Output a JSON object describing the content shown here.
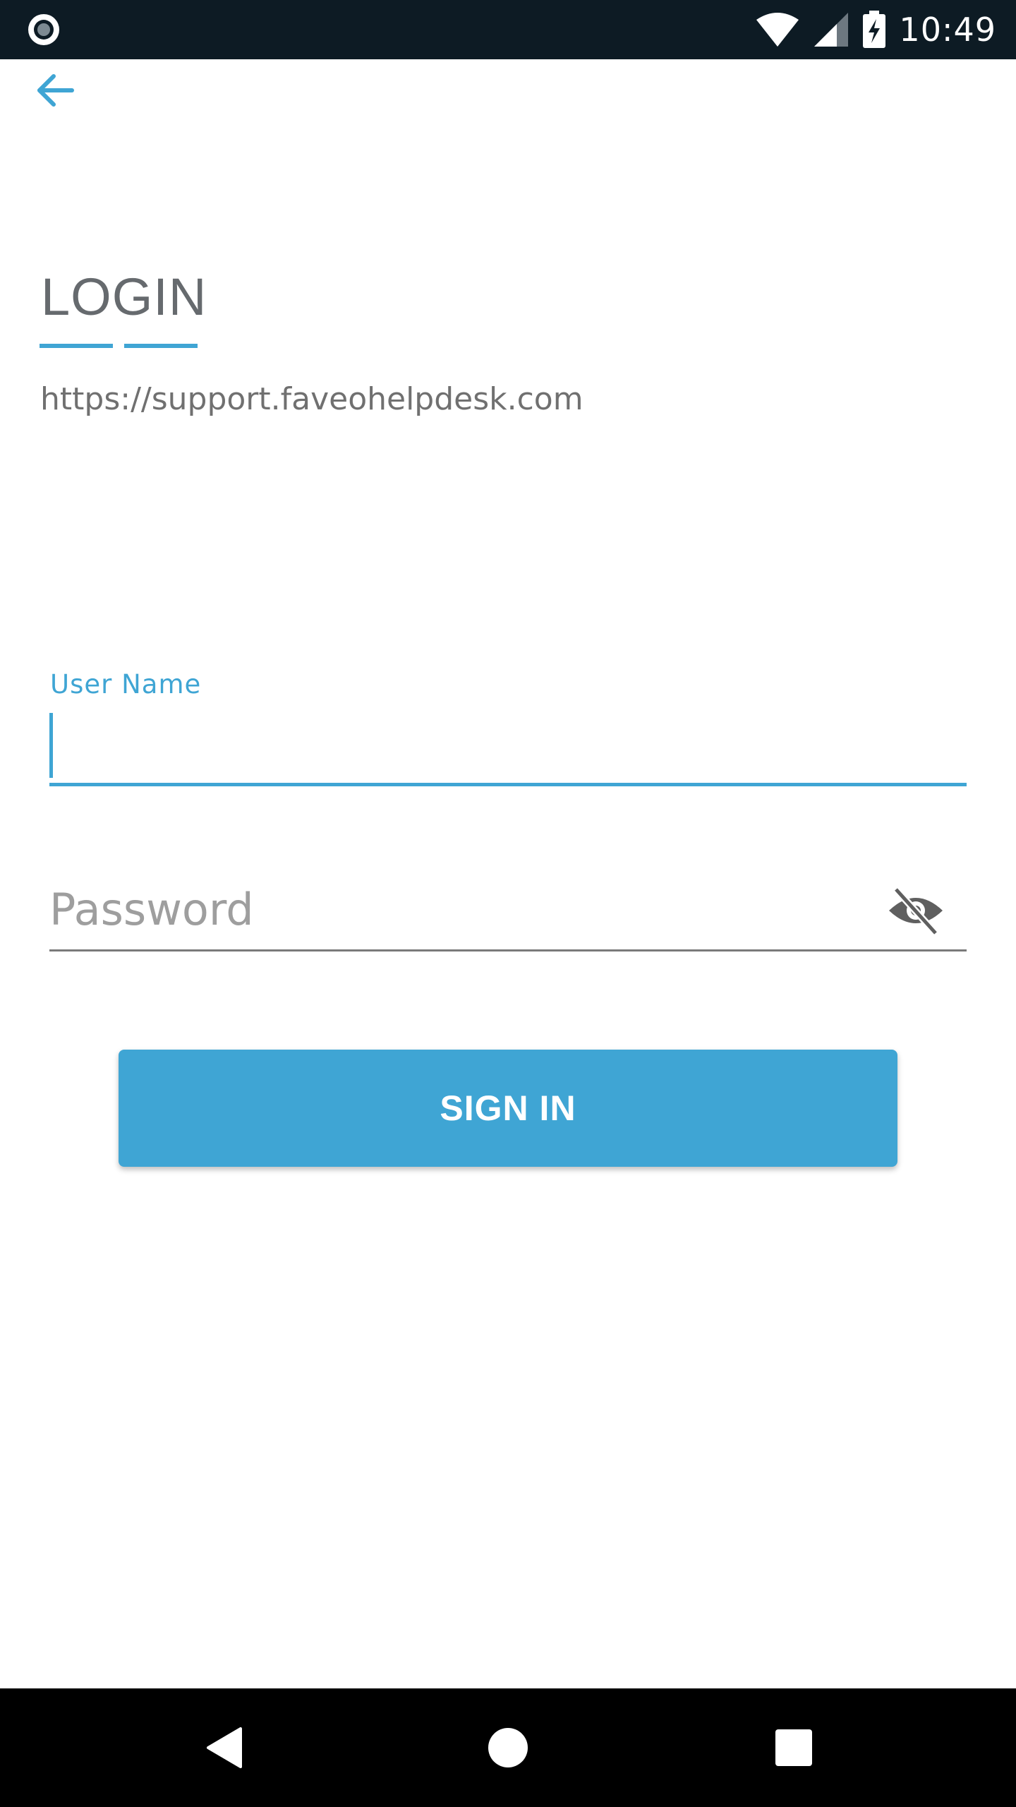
{
  "status_bar": {
    "time": "10:49",
    "left_icon": "record-icon",
    "icons": [
      "wifi-icon",
      "cellular-signal-icon",
      "battery-charging-icon"
    ]
  },
  "header": {
    "back_icon": "arrow-left-icon"
  },
  "login": {
    "title": "LOGIN",
    "server_url": "https://support.faveohelpdesk.com",
    "username_label": "User Name",
    "username_value": "",
    "password_placeholder": "Password",
    "password_value": "",
    "password_toggle_icon": "eye-off-icon",
    "signin_label": "SIGN IN"
  },
  "nav_bar": {
    "back_icon": "triangle-back-icon",
    "home_icon": "circle-home-icon",
    "recents_icon": "square-recents-icon"
  },
  "colors": {
    "accent": "#3fa5d4",
    "status_bar_bg": "#0d1b24",
    "title_text": "#666a6e",
    "nav_bar_bg": "#000000"
  }
}
